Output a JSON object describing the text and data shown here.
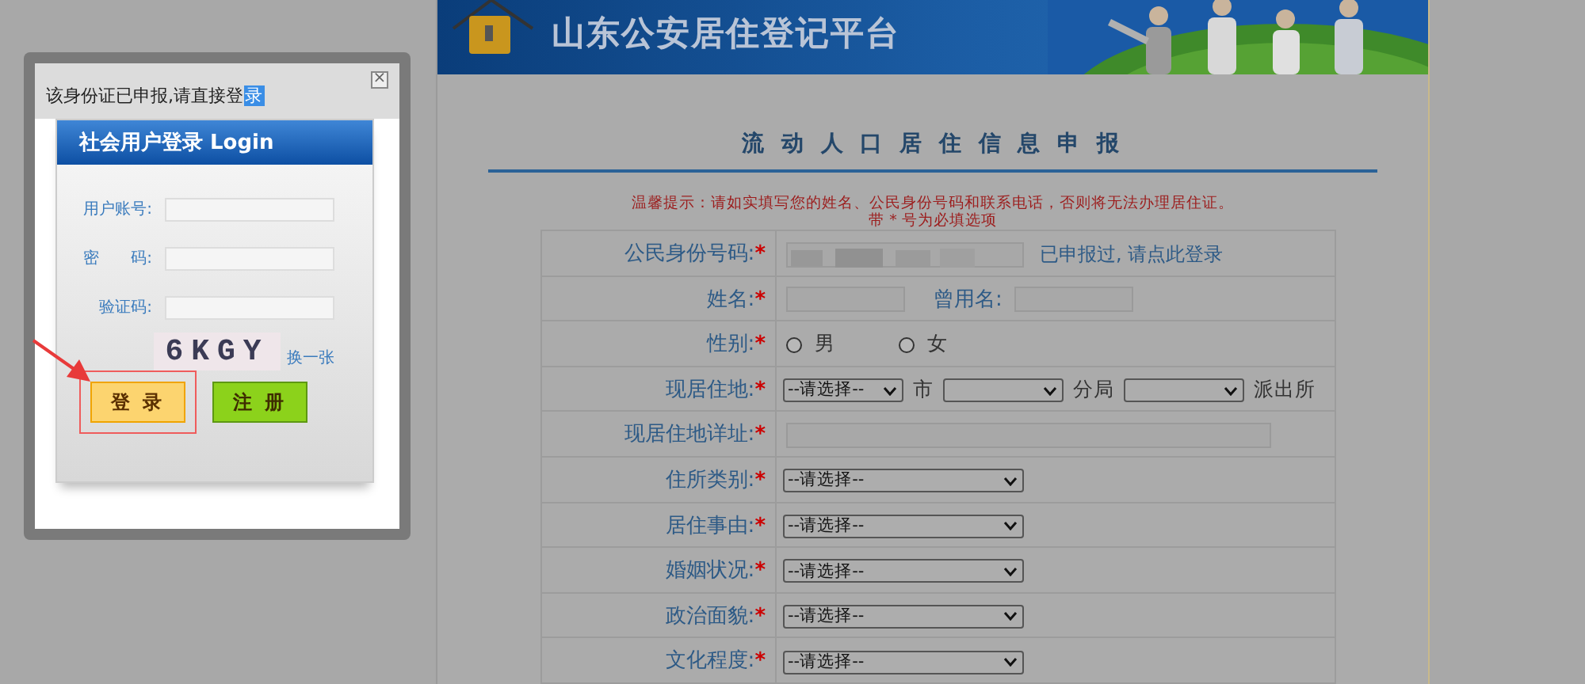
{
  "banner": {
    "title": "山东公安居住登记平台"
  },
  "form": {
    "title": "流 动 人 口 居 住 信 息 申 报",
    "notice": "温馨提示：请如实填写您的姓名、公民身份号码和联系电话，否则将无法办理居住证。",
    "required_note": "带 * 号为必填选项",
    "rows": [
      {
        "kind": "id",
        "label": "公民身份号码:",
        "mark": "*",
        "redacted": true,
        "link": "已申报过, 请点此登录"
      },
      {
        "kind": "text_pair",
        "label": "姓名:",
        "mark": "*",
        "second_label": "曾用名:"
      },
      {
        "kind": "radio",
        "label": "性别:",
        "mark": "*",
        "options": [
          {
            "label": "男",
            "selected": false
          },
          {
            "label": "女",
            "selected": false
          }
        ]
      },
      {
        "kind": "location",
        "label": "现居住地:",
        "mark": "*",
        "selects": [
          {
            "value": "--请选择--",
            "suffix": "市"
          },
          {
            "suffix": "分局"
          },
          {
            "suffix": "派出所"
          }
        ]
      },
      {
        "kind": "text",
        "label": "现居住地详址:",
        "mark": "*"
      },
      {
        "kind": "select",
        "label": "住所类别:",
        "mark": "*",
        "value": "--请选择--"
      },
      {
        "kind": "select",
        "label": "居住事由:",
        "mark": "*",
        "value": "--请选择--"
      },
      {
        "kind": "select",
        "label": "婚姻状况:",
        "mark": "*",
        "value": "--请选择--"
      },
      {
        "kind": "select",
        "label": "政治面貌:",
        "mark": "*",
        "value": "--请选择--"
      },
      {
        "kind": "select",
        "label": "文化程度:",
        "mark": "*",
        "value": "--请选择--"
      }
    ]
  },
  "dialog": {
    "message": [
      {
        "text": "该身份证已申报,请直接登",
        "selected": false
      },
      {
        "text": "录",
        "selected": true
      }
    ],
    "close": "×",
    "login": {
      "title": "社会用户登录 Login",
      "fields": [
        {
          "label": "用户账号:"
        },
        {
          "label": "密　　码:"
        },
        {
          "label": "验证码:"
        }
      ],
      "captcha": "6KGY",
      "refresh_link": "换一张",
      "buttons": [
        {
          "kind": "login",
          "label": "登 录",
          "highlighted": true
        },
        {
          "kind": "register",
          "label": "注 册",
          "highlighted": false
        }
      ]
    }
  }
}
